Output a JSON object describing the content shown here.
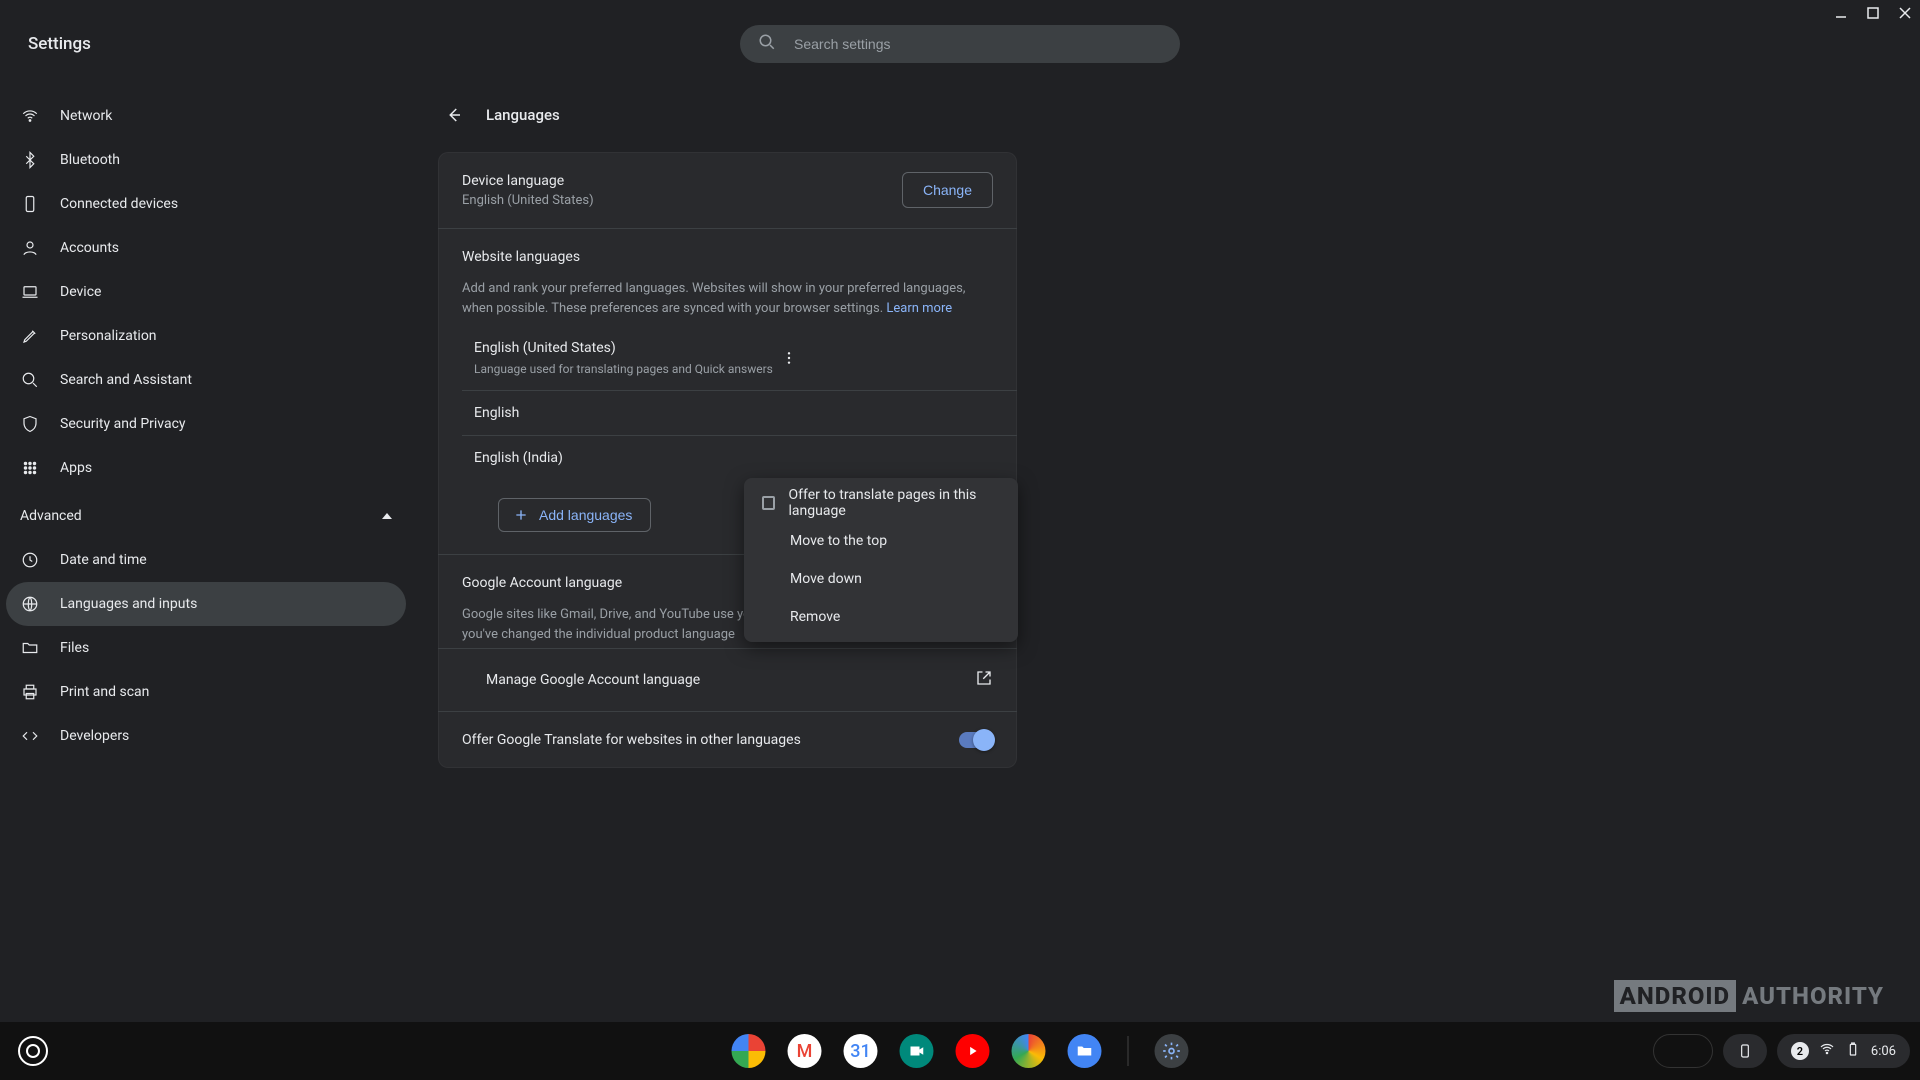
{
  "window": {
    "title": "Settings"
  },
  "search": {
    "placeholder": "Search settings"
  },
  "sidebar": {
    "items": [
      {
        "icon": "wifi",
        "label": "Network"
      },
      {
        "icon": "bluetooth",
        "label": "Bluetooth"
      },
      {
        "icon": "phone",
        "label": "Connected devices"
      },
      {
        "icon": "person",
        "label": "Accounts"
      },
      {
        "icon": "laptop",
        "label": "Device"
      },
      {
        "icon": "pencil",
        "label": "Personalization"
      },
      {
        "icon": "search",
        "label": "Search and Assistant"
      },
      {
        "icon": "shield",
        "label": "Security and Privacy"
      },
      {
        "icon": "grid",
        "label": "Apps"
      }
    ],
    "advanced_label": "Advanced",
    "adv_items": [
      {
        "icon": "clock",
        "label": "Date and time"
      },
      {
        "icon": "globe",
        "label": "Languages and inputs",
        "selected": true
      },
      {
        "icon": "folder",
        "label": "Files"
      },
      {
        "icon": "printer",
        "label": "Print and scan"
      },
      {
        "icon": "code",
        "label": "Developers"
      }
    ]
  },
  "page": {
    "title": "Languages",
    "device_lang": {
      "label": "Device language",
      "value": "English (United States)",
      "change_btn": "Change"
    },
    "website": {
      "title": "Website languages",
      "desc": "Add and rank your preferred languages. Websites will show in your preferred languages, when possible. These preferences are synced with your browser settings. ",
      "learn_more": "Learn more",
      "languages": [
        {
          "name": "English (United States)",
          "sub": "Language used for translating pages and Quick answers"
        },
        {
          "name": "English",
          "sub": ""
        },
        {
          "name": "English (India)",
          "sub": ""
        }
      ],
      "add_btn": "Add languages"
    },
    "google": {
      "title": "Google Account language",
      "desc": "Google sites like Gmail, Drive, and YouTube use your Google Account language unless you've changed the individual product language",
      "manage": "Manage Google Account language"
    },
    "translate": {
      "label": "Offer Google Translate for websites in other languages",
      "on": true
    }
  },
  "menu": {
    "items": [
      "Offer to translate pages in this language",
      "Move to the top",
      "Move down",
      "Remove"
    ]
  },
  "shelf": {
    "clock": "6:06",
    "notif_count": "2"
  },
  "watermark": {
    "brand": "ANDROID",
    "site": "AUTHORITY"
  }
}
